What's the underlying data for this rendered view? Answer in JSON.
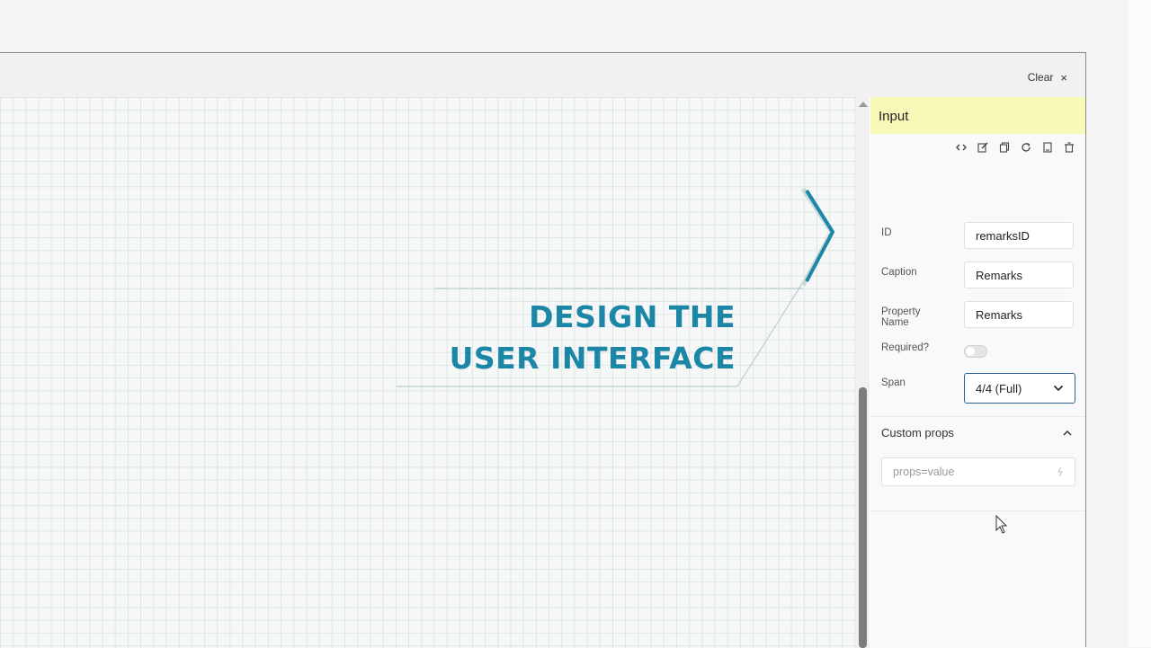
{
  "toolbar": {
    "clear_label": "Clear",
    "clear_icon": "×"
  },
  "overlay": {
    "line1": "DESIGN THE",
    "line2": "USER INTERFACE",
    "accent_color": "#1c86a6"
  },
  "panel": {
    "title": "Input",
    "tool_icons": [
      "code-icon",
      "edit-icon",
      "copy-icon",
      "refresh-icon",
      "duplicate-icon",
      "delete-icon"
    ],
    "fields": {
      "id": {
        "label": "ID",
        "value": "remarksID"
      },
      "caption": {
        "label": "Caption",
        "value": "Remarks"
      },
      "property_name": {
        "label": "Property Name",
        "value": "Remarks"
      },
      "required": {
        "label": "Required?",
        "checked": false
      },
      "span": {
        "label": "Span",
        "value": "4/4 (Full)"
      }
    },
    "custom_props": {
      "label": "Custom props",
      "placeholder": "props=value"
    }
  }
}
